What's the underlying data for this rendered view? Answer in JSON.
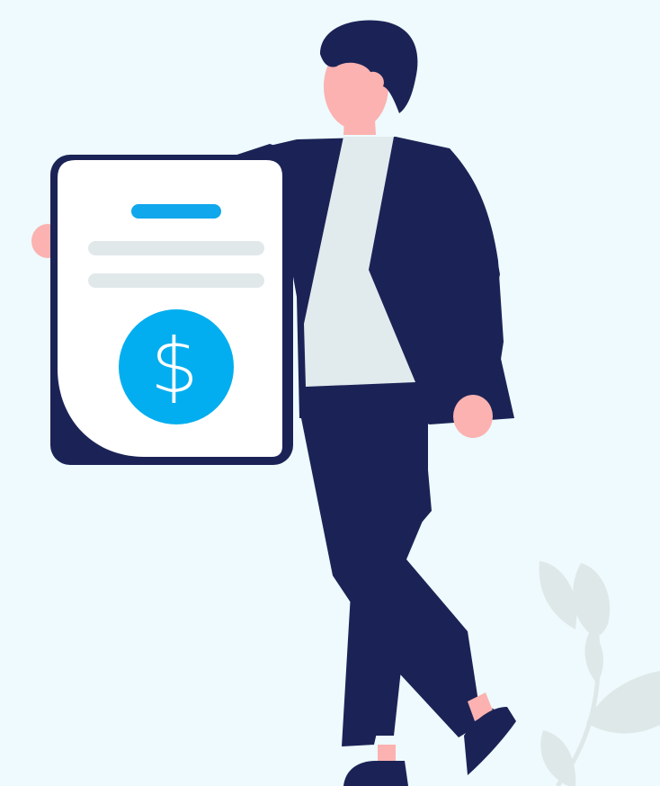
{
  "illustration": {
    "subject": "person-holding-invoice",
    "document_symbol": "$",
    "icons": [
      "dollar-icon",
      "leaf-plant-icon"
    ]
  },
  "colors": {
    "background": "#eefafd",
    "navy": "#1b2356",
    "skin": "#fbb2b0",
    "shirt": "#e1eaed",
    "paper": "#ffffff",
    "bar_accent": "#10a7ec",
    "bar_gray": "#e1e8ea",
    "coin": "#02aeef",
    "plant": "#dfe8e9"
  }
}
